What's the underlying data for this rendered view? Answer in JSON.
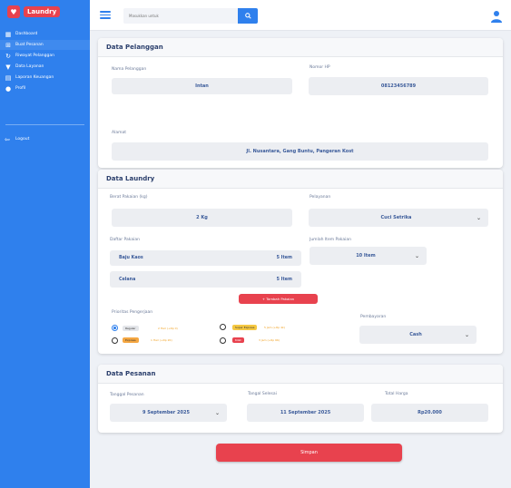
{
  "brand": {
    "name": "Laundry",
    "logo_badge": "♥"
  },
  "sidebar": {
    "items": [
      {
        "label": "Dashboard",
        "icon": "dashboard-icon"
      },
      {
        "label": "Buat Pesanan",
        "icon": "create-order-icon"
      },
      {
        "label": "Riwayat Pelanggan",
        "icon": "history-icon"
      },
      {
        "label": "Data Layanan",
        "icon": "cart-icon"
      },
      {
        "label": "Laporan Keuangan",
        "icon": "report-icon"
      },
      {
        "label": "Profil",
        "icon": "user-icon"
      }
    ],
    "logout_label": "Logout"
  },
  "topbar": {
    "search_placeholder": "Masukkan untuk"
  },
  "pelanggan": {
    "title": "Data Pelanggan",
    "nama_label": "Nama Pelanggan",
    "nama_value": "Intan",
    "hp_label": "Nomor HP",
    "hp_value": "08123456789",
    "alamat_label": "Alamat",
    "alamat_value": "Jl. Nusantara, Gang Buntu, Pangeran Kost"
  },
  "laundry": {
    "title": "Data Laundry",
    "berat_label": "Berat Pakaian (kg)",
    "berat_value": "2 Kg",
    "pelayanan_label": "Pelayanan",
    "pelayanan_value": "Cuci Setrika",
    "daftar_label": "Daftar Pakaian",
    "items": [
      {
        "name": "Baju Kaos",
        "qty": "5 Item"
      },
      {
        "name": "Celana",
        "qty": "5 Item"
      }
    ],
    "jumlah_label": "Jumlah Item Pakaian",
    "jumlah_value": "10 Item",
    "add_button": "+ Tambah Pakaian",
    "prioritas_label": "Prioritas Pengerjaan",
    "prioritas": [
      {
        "label": "Reguler",
        "note": "2 Hari (+Rp 0)",
        "color": "#e4e6ea",
        "checked": true
      },
      {
        "label": "Super Express",
        "note": "5 Jam (+Rp 4k)",
        "color": "#f5c842",
        "checked": false
      },
      {
        "label": "Express",
        "note": "1 Hari (+Rp 2K)",
        "color": "#f5a742",
        "checked": false
      },
      {
        "label": "Kilat",
        "note": "3 Jam (+Rp 6K)",
        "color": "#e8424e",
        "checked": false
      }
    ],
    "pembayaran_label": "Pembayaran",
    "pembayaran_value": "Cash"
  },
  "pesanan": {
    "title": "Data Pesanan",
    "tgl_pesanan_label": "Tanggal Pesanan",
    "tgl_pesanan_value": "9 September 2025",
    "tgl_selesai_label": "Tangal Selesai",
    "tgl_selesai_value": "11 September 2025",
    "total_label": "Total Harga",
    "total_value": "Rp20.000"
  },
  "save_button": "Simpan"
}
